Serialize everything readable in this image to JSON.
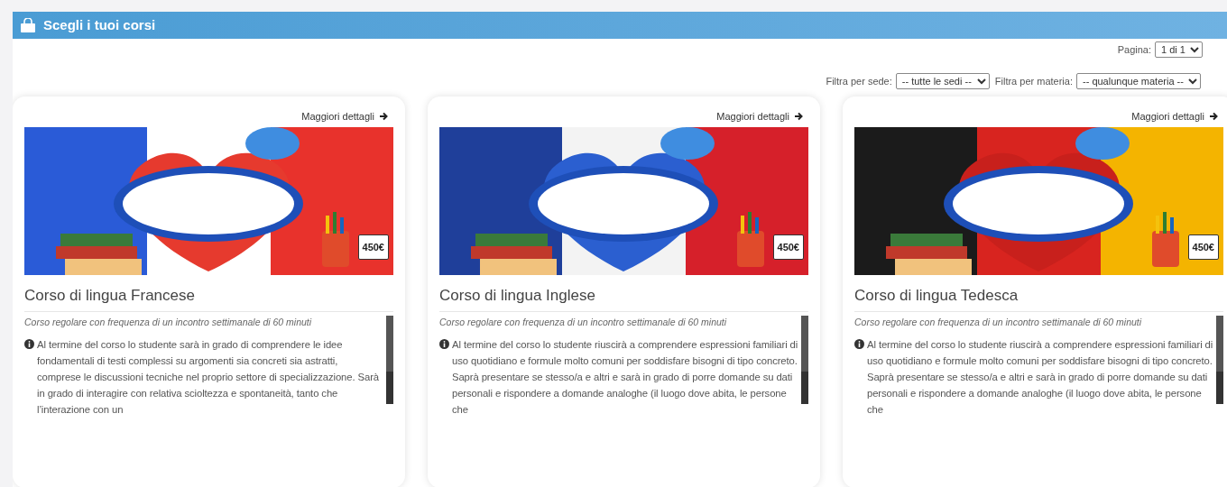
{
  "header": {
    "title": "Scegli i tuoi corsi"
  },
  "pagination": {
    "label": "Pagina:",
    "value": "1 di 1"
  },
  "filters": [
    {
      "label": "Filtra per sede:",
      "value": "-- tutte le sedi --"
    },
    {
      "label": "Filtra per materia:",
      "value": "-- qualunque materia --"
    }
  ],
  "courses": [
    {
      "details_link": "Maggiori dettagli",
      "price": "450€",
      "title": "Corso di lingua Francese",
      "subtitle": "Corso regolare con frequenza di un incontro settimanale di 60 minuti",
      "description": "Al termine del corso lo studente sarà in grado di comprendere le idee fondamentali di testi complessi su argomenti sia concreti sia astratti, comprese le discussioni tecniche nel proprio settore di specializzazione. Sarà in grado di interagire con relativa scioltezza e spontaneità, tanto che l’interazione con un"
    },
    {
      "details_link": "Maggiori dettagli",
      "price": "450€",
      "title": "Corso di lingua Inglese",
      "subtitle": "Corso regolare con frequenza di un incontro settimanale di 60 minuti",
      "description": "Al termine del corso lo studente riuscirà a comprendere espressioni familiari di uso quotidiano e formule molto comuni per soddisfare bisogni di tipo concreto. Saprà presentare se stesso/a e altri e sarà in grado di porre domande su dati personali e rispondere a domande analoghe (il luogo dove abita, le persone che"
    },
    {
      "details_link": "Maggiori dettagli",
      "price": "450€",
      "title": "Corso di lingua Tedesca",
      "subtitle": "Corso regolare con frequenza di un incontro settimanale di 60 minuti",
      "description": "Al termine del corso lo studente riuscirà a comprendere espressioni familiari di uso quotidiano e formule molto comuni per soddisfare bisogni di tipo concreto. Saprà presentare se stesso/a e altri e sarà in grado di porre domande su dati personali e rispondere a domande analoghe (il luogo dove abita, le persone che"
    }
  ]
}
